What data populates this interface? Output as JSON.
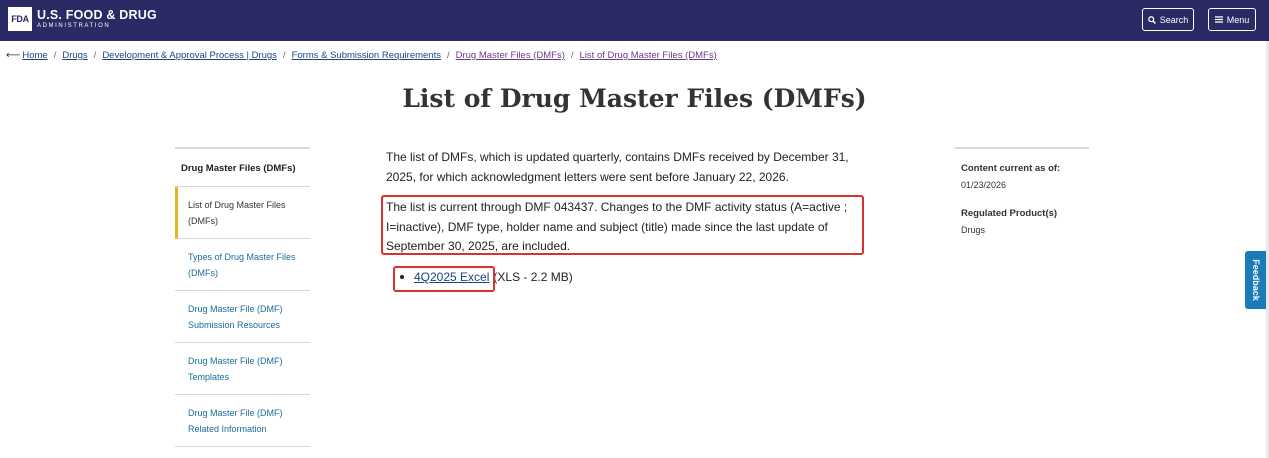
{
  "header": {
    "logo_mark": "FDA",
    "logo_title": "U.S. FOOD & DRUG",
    "logo_subtitle": "ADMINISTRATION",
    "search_label": "Search",
    "menu_label": "Menu"
  },
  "breadcrumb": {
    "items": [
      "Home",
      "Drugs",
      "Development & Approval Process | Drugs",
      "Forms & Submission Requirements",
      "Drug Master Files (DMFs)",
      "List of Drug Master Files (DMFs)"
    ],
    "separator": "/"
  },
  "page": {
    "title": "List of Drug Master Files (DMFs)"
  },
  "sidebar": {
    "heading": "Drug Master Files (DMFs)",
    "items": [
      {
        "label": "List of Drug Master Files (DMFs)"
      },
      {
        "label": "Types of Drug Master Files (DMFs)"
      },
      {
        "label": "Drug Master File (DMF) Submission Resources"
      },
      {
        "label": "Drug Master File (DMF) Templates"
      },
      {
        "label": "Drug Master File (DMF) Related Information"
      }
    ]
  },
  "content": {
    "para1": "The list of DMFs, which is updated quarterly, contains DMFs received by December 31, 2025, for which acknowledgment letters were sent before January 22, 2026.",
    "para2": "The list is current through DMF 043437. Changes to the DMF activity status (A=active ; I=inactive), DMF type, holder name and subject (title) made since the last update of September 30, 2025, are included.",
    "download_link": "4Q2025 Excel",
    "download_meta": "(XLS - 2.2 MB)"
  },
  "meta": {
    "content_current_label": "Content current as of:",
    "content_current_value": "01/23/2026",
    "regulated_label": "Regulated Product(s)",
    "regulated_value": "Drugs"
  },
  "feedback_label": "Feedback",
  "colors": {
    "header_bg": "#2a2a64",
    "link": "#1a4480",
    "sidebar_link": "#1a6b99",
    "active_accent": "#e6b325",
    "highlight_border": "#d93030",
    "feedback_bg": "#1a7bb8"
  }
}
